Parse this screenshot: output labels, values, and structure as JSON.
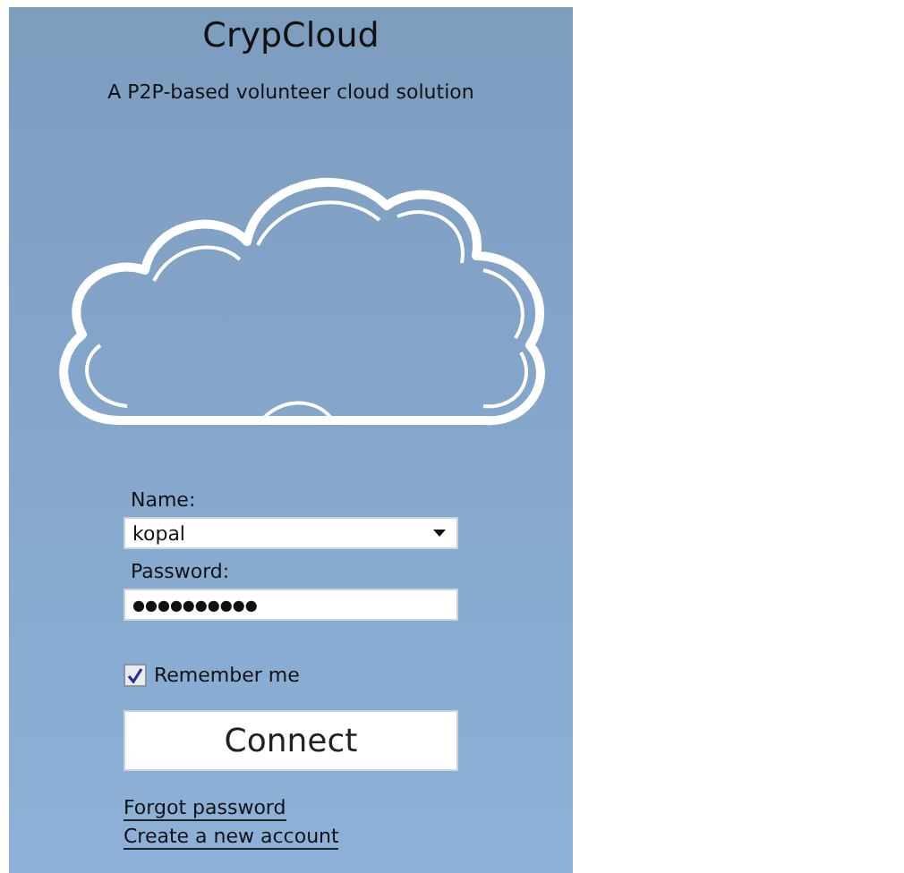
{
  "app": {
    "title": "CrypCloud",
    "subtitle": "A P2P-based volunteer cloud solution"
  },
  "login": {
    "name_label": "Name:",
    "name": {
      "value": "kopal"
    },
    "password_label": "Password:",
    "password": {
      "value": "●●●●●●●●●●"
    },
    "remember": {
      "label": "Remember me",
      "checked": true
    },
    "connect": "Connect"
  },
  "links": [
    "Forgot password",
    "Create a new account"
  ]
}
